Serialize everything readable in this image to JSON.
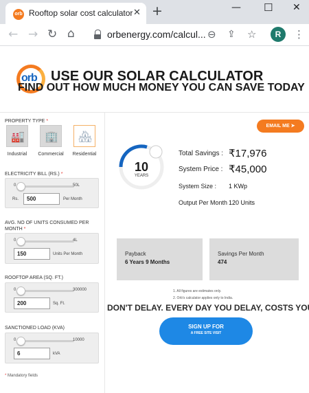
{
  "browser": {
    "tab_title": "Rooftop solar cost calculator",
    "favicon_text": "orb",
    "url": "orbenergy.com/calcul...",
    "profile_initial": "R"
  },
  "hero": {
    "logo_text": "orb",
    "title": "USE OUR SOLAR CALCULATOR",
    "subtitle": "FIND OUT HOW MUCH MONEY YOU CAN SAVE TODAY"
  },
  "form": {
    "property_type_label": "PROPERTY TYPE",
    "required_mark": "*",
    "property_types": [
      {
        "label": "Industrial",
        "icon": "factory-icon",
        "selected": false
      },
      {
        "label": "Commercial",
        "icon": "office-building-icon",
        "selected": false
      },
      {
        "label": "Residential",
        "icon": "house-icon",
        "selected": true
      }
    ],
    "electricity_bill": {
      "label": "ELECTRICITY BILL (RS.)",
      "min": "0",
      "max": "50L",
      "prefix": "Rs.",
      "value": "500",
      "unit": "Per Month",
      "fraction": 0.0
    },
    "units_consumed": {
      "label": "AVG. NO OF UNITS CONSUMED PER MONTH",
      "min": "0",
      "max": "4L",
      "value": "150",
      "unit": "Units Per Month",
      "fraction": 0.0
    },
    "rooftop_area": {
      "label": "ROOFTOP AREA (SQ. FT.)",
      "min": "0",
      "max": "300000",
      "value": "200",
      "unit": "Sq. Ft.",
      "fraction": 0.0
    },
    "sanctioned_load": {
      "label": "SANCTIONED LOAD (KVA)",
      "min": "0",
      "max": "10000",
      "value": "6",
      "unit": "kVA",
      "fraction": 0.0
    },
    "mandatory_note": "Mandatory fields"
  },
  "results": {
    "email_label": "EMAIL ME",
    "payback_years": "10",
    "payback_unit": "YEARS",
    "total_savings_label": "Total Savings :",
    "total_savings": "₹17,976",
    "system_price_label": "System Price :",
    "system_price": "₹45,000",
    "system_size_label": "System Size :",
    "system_size": "1 KWp",
    "output_label": "Output Per Month",
    "output_value": "120 Units",
    "payback_card_title": "Payback",
    "payback_card_value": "6 Years 9 Months",
    "savings_card_title": "Savings Per Month",
    "savings_card_value": "474",
    "footnote_1": "1. All figures are estimates only.",
    "footnote_2": "2. Orb's calculator applies only to India.",
    "cta_line": "DON'T DELAY. EVERY DAY YOU DELAY, COSTS YOU",
    "signup_label": "SIGN UP FOR",
    "signup_sub": "A FREE SITE VISIT"
  },
  "colors": {
    "accent": "#f47b20",
    "primary": "#1e88e5",
    "card": "#dcdcdc"
  }
}
